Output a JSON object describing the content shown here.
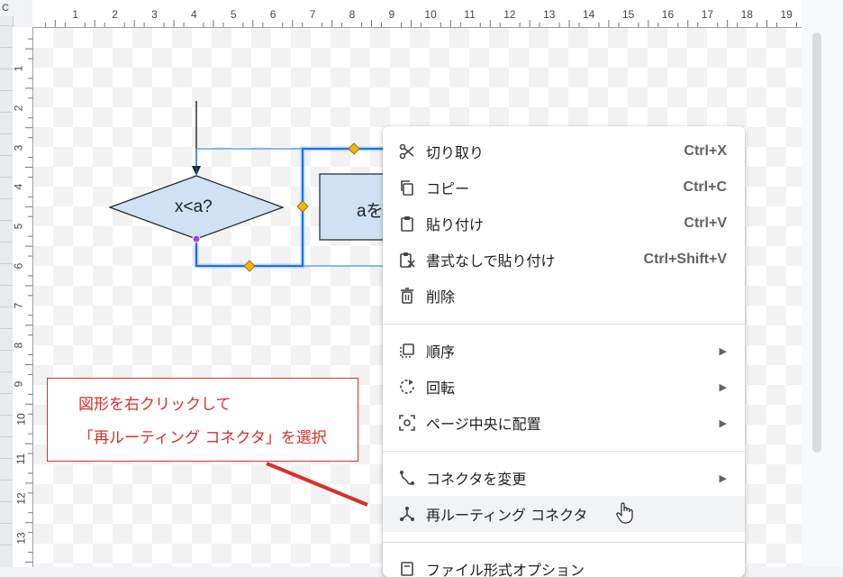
{
  "window": {
    "corner_letter": "C"
  },
  "ruler": {
    "top_numbers": [
      "1",
      "2",
      "3",
      "4",
      "5",
      "6",
      "7",
      "8",
      "9",
      "10",
      "11",
      "12",
      "13",
      "14",
      "15",
      "16",
      "17",
      "18",
      "19"
    ],
    "left_numbers": [
      "1",
      "2",
      "3",
      "4",
      "5",
      "6",
      "7",
      "8",
      "9",
      "10",
      "11",
      "12",
      "13"
    ]
  },
  "diagram": {
    "decision_label": "x<a?",
    "process_label": "aを"
  },
  "callout": {
    "line1": "図形を右クリックして",
    "line2": "「再ルーティング コネクタ」を選択",
    "color": "#d93025"
  },
  "context_menu": {
    "items": [
      {
        "id": "cut",
        "icon": "scissors-icon",
        "label": "切り取り",
        "shortcut": "Ctrl+X"
      },
      {
        "id": "copy",
        "icon": "copy-icon",
        "label": "コピー",
        "shortcut": "Ctrl+C"
      },
      {
        "id": "paste",
        "icon": "clipboard-icon",
        "label": "貼り付け",
        "shortcut": "Ctrl+V"
      },
      {
        "id": "paste-plain",
        "icon": "clipboard-plain-icon",
        "label": "書式なしで貼り付け",
        "shortcut": "Ctrl+Shift+V"
      },
      {
        "id": "delete",
        "icon": "trash-icon",
        "label": "削除",
        "shortcut": ""
      },
      {
        "id": "order",
        "icon": "order-icon",
        "label": "順序",
        "submenu": true
      },
      {
        "id": "rotate",
        "icon": "rotate-icon",
        "label": "回転",
        "submenu": true
      },
      {
        "id": "center",
        "icon": "center-icon",
        "label": "ページ中央に配置",
        "submenu": true
      },
      {
        "id": "change-connector",
        "icon": "connector-icon",
        "label": "コネクタを変更",
        "submenu": true
      },
      {
        "id": "reroute",
        "icon": "reroute-icon",
        "label": "再ルーティング コネクタ",
        "hover": true
      },
      {
        "id": "file-format",
        "icon": "format-icon",
        "label": "ファイル形式オプション"
      }
    ]
  },
  "colors": {
    "selection": "#1a73e8",
    "shape_fill": "#cfe2f3",
    "handle": "#f4b400"
  }
}
